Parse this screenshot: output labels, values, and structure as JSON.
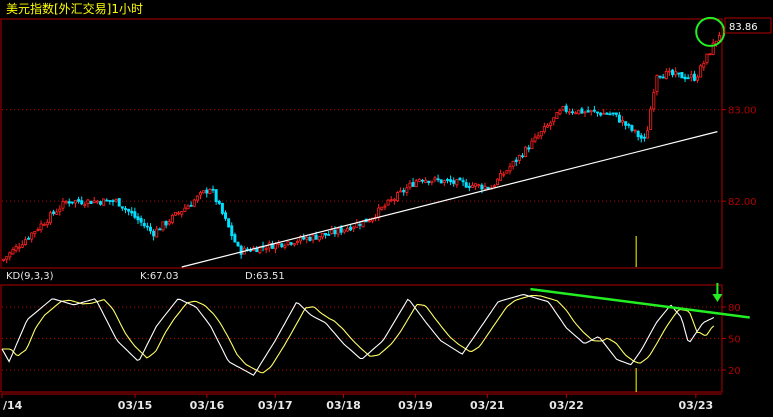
{
  "chart_data": [
    {
      "type": "candlestick",
      "title": "美元指数[外汇交易]1小时",
      "last_price_label": "83.86",
      "y_ticks": [
        {
          "value": 83.0,
          "label": "83.00"
        },
        {
          "value": 82.0,
          "label": "82.00"
        }
      ],
      "ylim": [
        81.28,
        83.98
      ],
      "grid": true,
      "trendline": {
        "x": [
          0.25,
          0.995
        ],
        "y": [
          81.28,
          82.76
        ]
      },
      "overlays": [
        {
          "name": "current-price-highlight",
          "x": 0.985,
          "y": 83.85
        }
      ],
      "segments": [
        {
          "x0": 0.0,
          "x1": 0.09,
          "start": 81.35,
          "end": 82.0
        },
        {
          "x0": 0.09,
          "x1": 0.16,
          "start": 82.0,
          "end": 82.0
        },
        {
          "x0": 0.16,
          "x1": 0.21,
          "start": 82.0,
          "end": 81.65
        },
        {
          "x0": 0.21,
          "x1": 0.29,
          "start": 81.65,
          "end": 82.15
        },
        {
          "x0": 0.29,
          "x1": 0.33,
          "start": 82.15,
          "end": 81.45
        },
        {
          "x0": 0.33,
          "x1": 0.46,
          "start": 81.45,
          "end": 81.65
        },
        {
          "x0": 0.46,
          "x1": 0.51,
          "start": 81.65,
          "end": 81.8
        },
        {
          "x0": 0.51,
          "x1": 0.58,
          "start": 81.8,
          "end": 82.25
        },
        {
          "x0": 0.58,
          "x1": 0.68,
          "start": 82.25,
          "end": 82.15
        },
        {
          "x0": 0.68,
          "x1": 0.78,
          "start": 82.15,
          "end": 83.0
        },
        {
          "x0": 0.78,
          "x1": 0.85,
          "start": 83.0,
          "end": 82.95
        },
        {
          "x0": 0.85,
          "x1": 0.895,
          "start": 82.95,
          "end": 82.65
        },
        {
          "x0": 0.895,
          "x1": 0.91,
          "start": 82.65,
          "end": 83.4
        },
        {
          "x0": 0.91,
          "x1": 0.965,
          "start": 83.4,
          "end": 83.35
        },
        {
          "x0": 0.965,
          "x1": 1.0,
          "start": 83.35,
          "end": 83.86
        }
      ],
      "candle_count": 230,
      "seed": 7
    },
    {
      "type": "line",
      "title": "KD(9,3,3)",
      "series": [
        {
          "name": "K",
          "label": "K:67.03",
          "color": "#ffffff"
        },
        {
          "name": "D",
          "label": "D:63.51",
          "color": "#ffff66"
        }
      ],
      "y_ticks": [
        {
          "value": 80,
          "label": "80"
        },
        {
          "value": 50,
          "label": "50"
        },
        {
          "value": 20,
          "label": "20"
        }
      ],
      "ylim": [
        0,
        100
      ],
      "k_profile": [
        [
          0.0,
          40
        ],
        [
          0.01,
          28
        ],
        [
          0.035,
          68
        ],
        [
          0.07,
          88
        ],
        [
          0.1,
          82
        ],
        [
          0.13,
          88
        ],
        [
          0.16,
          48
        ],
        [
          0.19,
          28
        ],
        [
          0.215,
          62
        ],
        [
          0.245,
          88
        ],
        [
          0.27,
          80
        ],
        [
          0.29,
          62
        ],
        [
          0.315,
          28
        ],
        [
          0.35,
          15
        ],
        [
          0.38,
          48
        ],
        [
          0.41,
          85
        ],
        [
          0.43,
          72
        ],
        [
          0.45,
          65
        ],
        [
          0.475,
          45
        ],
        [
          0.5,
          30
        ],
        [
          0.53,
          48
        ],
        [
          0.565,
          88
        ],
        [
          0.59,
          65
        ],
        [
          0.61,
          48
        ],
        [
          0.64,
          35
        ],
        [
          0.665,
          60
        ],
        [
          0.69,
          85
        ],
        [
          0.725,
          92
        ],
        [
          0.76,
          85
        ],
        [
          0.785,
          60
        ],
        [
          0.81,
          45
        ],
        [
          0.83,
          52
        ],
        [
          0.855,
          30
        ],
        [
          0.875,
          25
        ],
        [
          0.89,
          40
        ],
        [
          0.91,
          65
        ],
        [
          0.93,
          82
        ],
        [
          0.945,
          70
        ],
        [
          0.955,
          45
        ],
        [
          0.975,
          65
        ],
        [
          0.99,
          70
        ]
      ],
      "divergence_line": {
        "x": [
          0.735,
          1.04
        ],
        "y": [
          97,
          70
        ]
      },
      "marker": {
        "name": "down-arrow",
        "x": 0.995,
        "y": 100
      }
    }
  ],
  "x_axis": {
    "labels": [
      "/14",
      "03/15",
      "03/16",
      "03/17",
      "03/18",
      "03/19",
      "03/21",
      "03/22",
      "03/23"
    ],
    "positions": [
      0.0,
      0.185,
      0.285,
      0.38,
      0.475,
      0.575,
      0.675,
      0.785,
      0.965
    ]
  },
  "colors": {
    "background": "#000000",
    "frame": "#b00000",
    "up_candle": "#ff2020",
    "down_candle": "#00e0ff",
    "trendline": "#ffffff",
    "divergence": "#22ee22",
    "highlight": "#22ee22",
    "axis_text": "#e8e8e8",
    "title": "#ffff00",
    "marker_line": "#ffff00"
  }
}
